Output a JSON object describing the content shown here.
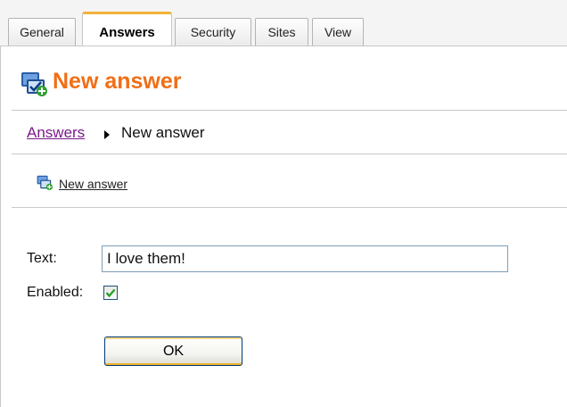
{
  "tabs": [
    {
      "label": "General",
      "active": false
    },
    {
      "label": "Answers",
      "active": true
    },
    {
      "label": "Security",
      "active": false
    },
    {
      "label": "Sites",
      "active": false
    },
    {
      "label": "View",
      "active": false
    }
  ],
  "header": {
    "title": "New answer",
    "title_color": "#f06f17",
    "icon": "new-answer-icon"
  },
  "breadcrumb": {
    "parent": "Answers",
    "current": "New answer"
  },
  "actions": {
    "new_answer": "New answer",
    "icon": "new-answer-icon"
  },
  "form": {
    "text_label": "Text:",
    "text_value": "I love them!",
    "enabled_label": "Enabled:",
    "enabled_checked": true,
    "ok_label": "OK"
  }
}
